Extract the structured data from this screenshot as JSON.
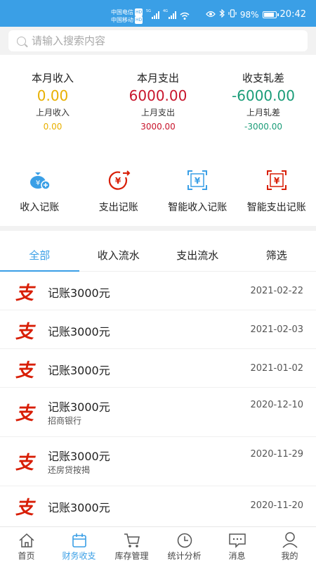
{
  "status": {
    "carrier1": "中国电信",
    "carrier2": "中国移动",
    "hd": "HD",
    "net1": "5G",
    "net2": "4G",
    "battery": "98%",
    "time": "20:42"
  },
  "search": {
    "placeholder": "请输入搜索内容"
  },
  "summary": {
    "income": {
      "title": "本月收入",
      "value": "0.00",
      "sub_label": "上月收入",
      "sub_value": "0.00"
    },
    "expense": {
      "title": "本月支出",
      "value": "6000.00",
      "sub_label": "上月支出",
      "sub_value": "3000.00"
    },
    "balance": {
      "title": "收支轧差",
      "value": "-6000.00",
      "sub_label": "上月轧差",
      "sub_value": "-3000.00"
    }
  },
  "actions": [
    {
      "label": "收入记账",
      "icon": "money-bag-icon"
    },
    {
      "label": "支出记账",
      "icon": "yuan-out-icon"
    },
    {
      "label": "智能收入记账",
      "icon": "smart-income-icon"
    },
    {
      "label": "智能支出记账",
      "icon": "smart-expense-icon"
    }
  ],
  "tabs": [
    {
      "label": "全部",
      "active": true
    },
    {
      "label": "收入流水",
      "active": false
    },
    {
      "label": "支出流水",
      "active": false
    },
    {
      "label": "筛选",
      "active": false
    }
  ],
  "records": [
    {
      "badge": "支",
      "title": "记账3000元",
      "date": "2021-02-22",
      "note": ""
    },
    {
      "badge": "支",
      "title": "记账3000元",
      "date": "2021-02-03",
      "note": ""
    },
    {
      "badge": "支",
      "title": "记账3000元",
      "date": "2021-01-02",
      "note": ""
    },
    {
      "badge": "支",
      "title": "记账3000元",
      "date": "2020-12-10",
      "note": "招商银行"
    },
    {
      "badge": "支",
      "title": "记账3000元",
      "date": "2020-11-29",
      "note": "还房贷按揭"
    },
    {
      "badge": "支",
      "title": "记账3000元",
      "date": "2020-11-20",
      "note": ""
    }
  ],
  "nav": [
    {
      "label": "首页",
      "icon": "home-icon",
      "active": false
    },
    {
      "label": "财务收支",
      "icon": "calendar-icon",
      "active": true
    },
    {
      "label": "库存管理",
      "icon": "cart-icon",
      "active": false
    },
    {
      "label": "统计分析",
      "icon": "clock-icon",
      "active": false
    },
    {
      "label": "消息",
      "icon": "message-icon",
      "active": false
    },
    {
      "label": "我的",
      "icon": "user-icon",
      "active": false
    }
  ],
  "colors": {
    "accent": "#3a9fe6",
    "income": "#e8b000",
    "expense": "#c8152c",
    "balance": "#1a9c78"
  }
}
